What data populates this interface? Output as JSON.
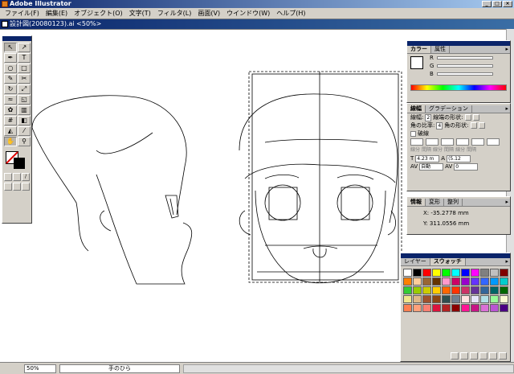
{
  "app": {
    "title": "Adobe Illustrator"
  },
  "menu": [
    "ファイル(F)",
    "編集(E)",
    "オブジェクト(O)",
    "文字(T)",
    "フィルタ(L)",
    "画面(V)",
    "ウインドウ(W)",
    "ヘルプ(H)"
  ],
  "document": {
    "title": "設計図(20080123).ai <50%>"
  },
  "status": {
    "zoom": "50%",
    "tool_text": "手のひら"
  },
  "color_panel": {
    "tabs": [
      "カラー",
      "属性"
    ],
    "sliders": [
      "R",
      "G",
      "B"
    ]
  },
  "stroke_panel": {
    "tabs": [
      "線幅",
      "グラデーション"
    ],
    "weight_label": "線幅:",
    "weight_value": "2",
    "cap_label": "線端の形状:",
    "miter_label": "角の比率:",
    "miter_value": "4",
    "join_label": "角の形状:",
    "dashed_label": "破線",
    "dash_labels": [
      "線分",
      "間隔",
      "線分",
      "間隔",
      "線分",
      "間隔"
    ]
  },
  "char_panel": {
    "size_value": "4.23 m",
    "leading_value": "(5.12",
    "tracking_value": "自動",
    "kerning_value": "0"
  },
  "info_panel": {
    "tabs": [
      "情報",
      "変形",
      "整列"
    ],
    "x": "X: -35.2778 mm",
    "y": "Y: 311.0556 mm"
  },
  "swatch_panel": {
    "tabs": [
      "レイヤー",
      "スウォッチ"
    ]
  },
  "colors": {
    "title_blue": "#0a246a",
    "panel_gray": "#d4d0c8",
    "canvas": "#ffffff"
  },
  "swatches": [
    "#ffffff",
    "#000000",
    "#ff0000",
    "#ffff00",
    "#00ff00",
    "#00ffff",
    "#0000ff",
    "#ff00ff",
    "#808080",
    "#c0c0c0",
    "#800000",
    "#ff8000",
    "#ffcc99",
    "#996633",
    "#663300",
    "#ff99cc",
    "#cc0066",
    "#9900cc",
    "#6633ff",
    "#3366ff",
    "#0099ff",
    "#00cccc",
    "#33cc33",
    "#99cc00",
    "#cccc00",
    "#ffcc00",
    "#ff6600",
    "#ff3300",
    "#cc3366",
    "#663399",
    "#336699",
    "#006666",
    "#006600",
    "#f0e68c",
    "#deb887",
    "#a0522d",
    "#8b4513",
    "#2f4f4f",
    "#708090",
    "#ffe4e1",
    "#e6e6fa",
    "#b0e0e6",
    "#98fb98",
    "#fafad2",
    "#ff7f50",
    "#ffa07a",
    "#fa8072",
    "#dc143c",
    "#b22222",
    "#8b0000",
    "#ff1493",
    "#c71585",
    "#da70d6",
    "#ba55d3",
    "#4b0082"
  ]
}
